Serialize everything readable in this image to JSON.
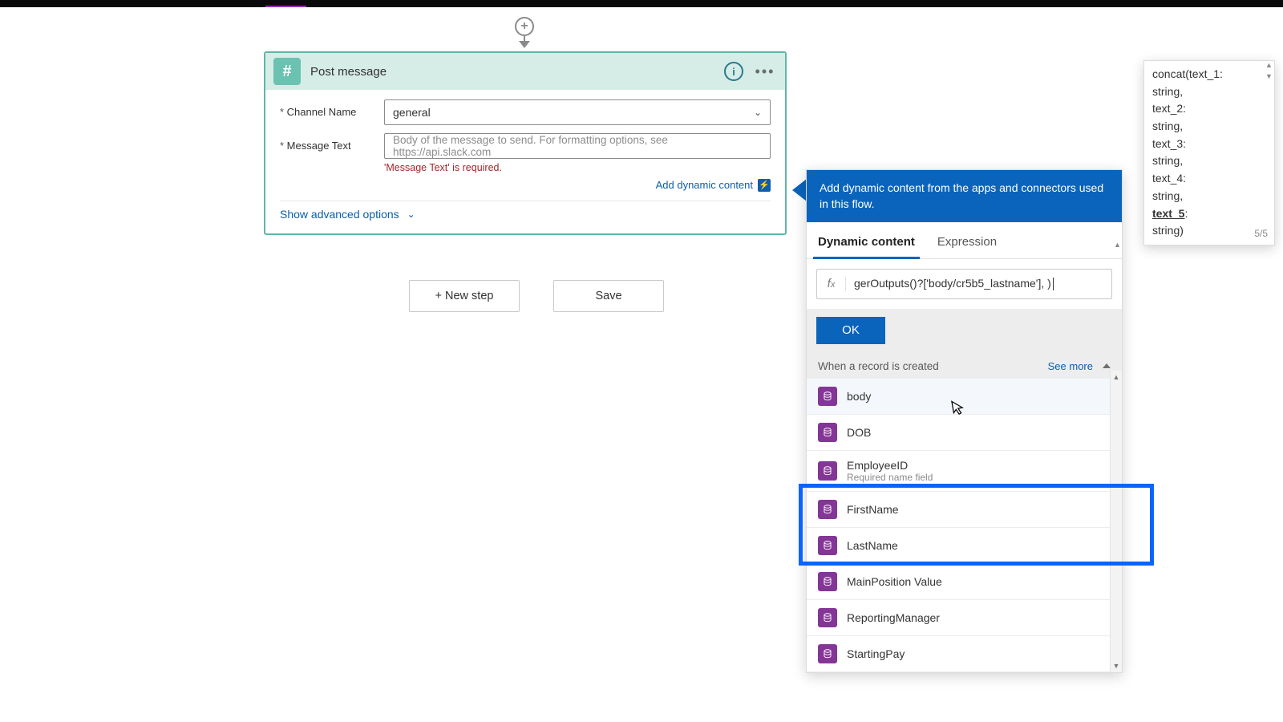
{
  "card": {
    "title": "Post message",
    "channel_label": "Channel Name",
    "channel_value": "general",
    "message_label": "Message Text",
    "message_placeholder": "Body of the message to send. For formatting options, see https://api.slack.com",
    "message_error": "'Message Text' is required.",
    "add_dynamic": "Add dynamic content",
    "advanced": "Show advanced options"
  },
  "buttons": {
    "new_step": "+ New step",
    "save": "Save"
  },
  "dynamic": {
    "header": "Add dynamic content from the apps and connectors used in this flow.",
    "tabs": {
      "dynamic": "Dynamic content",
      "expression": "Expression"
    },
    "expression_value": "gerOutputs()?['body/cr5b5_lastname'], )",
    "ok": "OK",
    "group": "When a record is created",
    "see_more": "See more",
    "items": [
      {
        "label": "body",
        "sub": ""
      },
      {
        "label": "DOB",
        "sub": ""
      },
      {
        "label": "EmployeeID",
        "sub": "Required name field"
      },
      {
        "label": "FirstName",
        "sub": ""
      },
      {
        "label": "LastName",
        "sub": ""
      },
      {
        "label": "MainPosition Value",
        "sub": ""
      },
      {
        "label": "ReportingManager",
        "sub": ""
      },
      {
        "label": "StartingPay",
        "sub": ""
      }
    ]
  },
  "tooltip": {
    "lines": [
      "concat(text_1:",
      "string,",
      "text_2:",
      "string,",
      "text_3:",
      "string,",
      "text_4:",
      "string,"
    ],
    "bold": "text_5",
    "tail": ":",
    "last": "string)",
    "count": "5/5"
  }
}
